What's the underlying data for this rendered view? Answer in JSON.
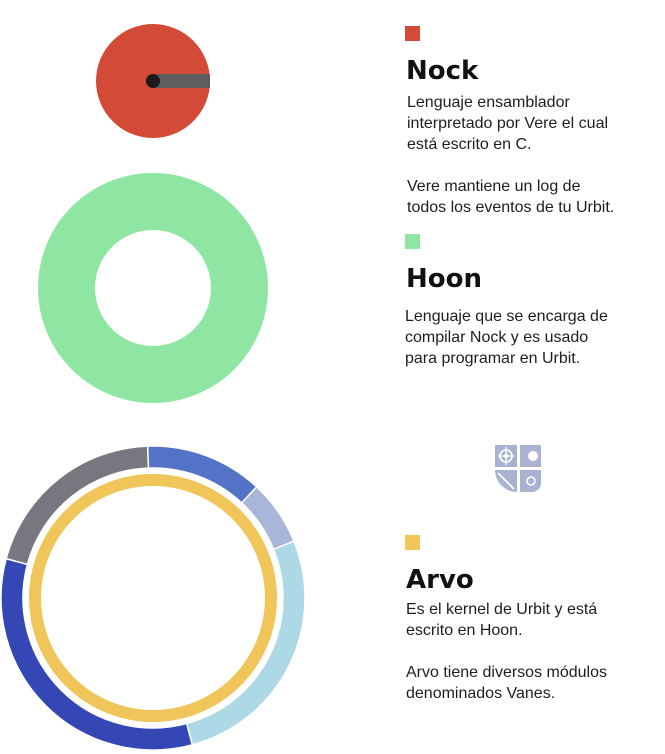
{
  "colors": {
    "nock": "#d34a36",
    "hoon": "#8ee6a2",
    "arvo": "#f0c55a",
    "nock_bar": "#5e5e5e",
    "nock_dot": "#1a1a1a",
    "arvo_outer_ring": [
      "#add8e6",
      "#3447b5",
      "#77777f",
      "#5472c6",
      "#a8b7d9"
    ],
    "logo": "#a9b2d3"
  },
  "icons": {
    "logo": "urbit-logo-icon"
  },
  "sections": {
    "nock": {
      "title": "Nock",
      "description": "Lenguaje ensamblador\ninterpretado por Vere el cual\nestá escrito en C.\n\nVere mantiene un log de\ntodos los eventos de tu Urbit."
    },
    "hoon": {
      "title": "Hoon",
      "description": "Lenguaje que se encarga de\ncompilar Nock y es usado\npara programar en Urbit."
    },
    "arvo": {
      "title": "Arvo",
      "description": "Es el kernel de Urbit y está\nescrito en Hoon.\n\nArvo tiene diversos módulos\ndenominados Vanes."
    }
  }
}
